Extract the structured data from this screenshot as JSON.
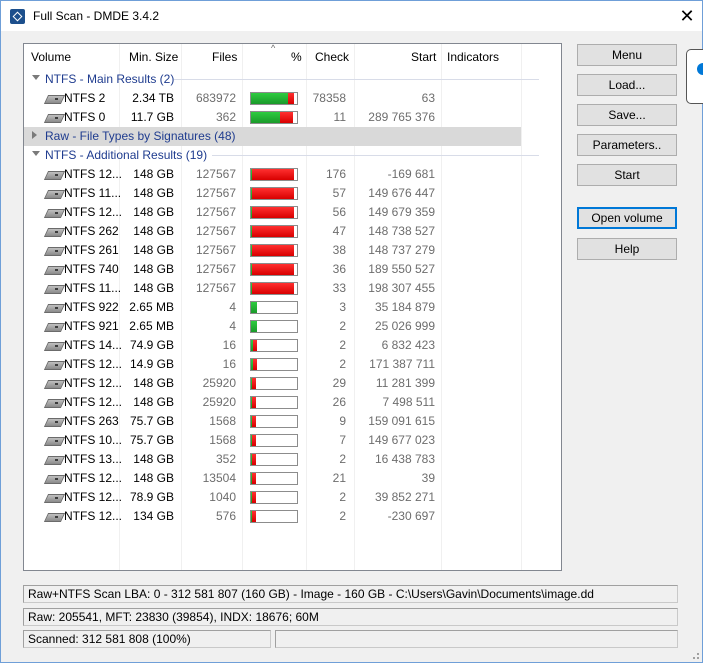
{
  "window": {
    "title": "Full Scan - DMDE 3.4.2",
    "close_glyph": "✕"
  },
  "columns": {
    "volume": "Volume",
    "min_size": "Min. Size",
    "files": "Files",
    "percent": "%",
    "check": "Check",
    "start": "Start",
    "indicators": "Indicators"
  },
  "groups": {
    "main": "NTFS - Main Results (2)",
    "raw": "Raw - File Types by Signatures (48)",
    "additional": "NTFS - Additional Results (19)"
  },
  "main_rows": [
    {
      "volume": "NTFS 2",
      "size": "2.34 TB",
      "files": "683972",
      "green": 0.8,
      "red": 0.14,
      "check": "78358",
      "start": "63"
    },
    {
      "volume": "NTFS 0",
      "size": "11.7 GB",
      "files": "362",
      "green": 0.62,
      "red": 0.28,
      "check": "11",
      "start": "289 765 376"
    }
  ],
  "additional_rows": [
    {
      "volume": "NTFS 12...",
      "size": "148 GB",
      "files": "127567",
      "green": 0.03,
      "red": 0.92,
      "check": "176",
      "start": "-169 681"
    },
    {
      "volume": "NTFS 11...",
      "size": "148 GB",
      "files": "127567",
      "green": 0.03,
      "red": 0.92,
      "check": "57",
      "start": "149 676 447"
    },
    {
      "volume": "NTFS 12...",
      "size": "148 GB",
      "files": "127567",
      "green": 0.03,
      "red": 0.92,
      "check": "56",
      "start": "149 679 359"
    },
    {
      "volume": "NTFS 262",
      "size": "148 GB",
      "files": "127567",
      "green": 0.03,
      "red": 0.92,
      "check": "47",
      "start": "148 738 527"
    },
    {
      "volume": "NTFS 261",
      "size": "148 GB",
      "files": "127567",
      "green": 0.03,
      "red": 0.92,
      "check": "38",
      "start": "148 737 279"
    },
    {
      "volume": "NTFS 740",
      "size": "148 GB",
      "files": "127567",
      "green": 0.03,
      "red": 0.92,
      "check": "36",
      "start": "189 550 527"
    },
    {
      "volume": "NTFS 11...",
      "size": "148 GB",
      "files": "127567",
      "green": 0.03,
      "red": 0.92,
      "check": "33",
      "start": "198 307 455"
    },
    {
      "volume": "NTFS 922",
      "size": "2.65 MB",
      "files": "4",
      "green": 0.12,
      "red": 0.0,
      "check": "3",
      "start": "35 184 879"
    },
    {
      "volume": "NTFS 921",
      "size": "2.65 MB",
      "files": "4",
      "green": 0.12,
      "red": 0.0,
      "check": "2",
      "start": "25 026 999"
    },
    {
      "volume": "NTFS 14...",
      "size": "74.9 GB",
      "files": "16",
      "green": 0.05,
      "red": 0.08,
      "check": "2",
      "start": "6 832 423"
    },
    {
      "volume": "NTFS 12...",
      "size": "14.9 GB",
      "files": "16",
      "green": 0.05,
      "red": 0.08,
      "check": "2",
      "start": "171 387 711"
    },
    {
      "volume": "NTFS 12...",
      "size": "148 GB",
      "files": "25920",
      "green": 0.03,
      "red": 0.08,
      "check": "29",
      "start": "11 281 399"
    },
    {
      "volume": "NTFS 12...",
      "size": "148 GB",
      "files": "25920",
      "green": 0.03,
      "red": 0.08,
      "check": "26",
      "start": "7 498 511"
    },
    {
      "volume": "NTFS 263",
      "size": "75.7 GB",
      "files": "1568",
      "green": 0.03,
      "red": 0.08,
      "check": "9",
      "start": "159 091 615"
    },
    {
      "volume": "NTFS 10...",
      "size": "75.7 GB",
      "files": "1568",
      "green": 0.03,
      "red": 0.08,
      "check": "7",
      "start": "149 677 023"
    },
    {
      "volume": "NTFS 13...",
      "size": "148 GB",
      "files": "352",
      "green": 0.03,
      "red": 0.08,
      "check": "2",
      "start": "16 438 783"
    },
    {
      "volume": "NTFS 12...",
      "size": "148 GB",
      "files": "13504",
      "green": 0.03,
      "red": 0.08,
      "check": "21",
      "start": "39"
    },
    {
      "volume": "NTFS 12...",
      "size": "78.9 GB",
      "files": "1040",
      "green": 0.03,
      "red": 0.08,
      "check": "2",
      "start": "39 852 271"
    },
    {
      "volume": "NTFS 12...",
      "size": "134 GB",
      "files": "576",
      "green": 0.03,
      "red": 0.08,
      "check": "2",
      "start": "-230 697"
    }
  ],
  "buttons": {
    "menu": "Menu",
    "load": "Load...",
    "save": "Save...",
    "parameters": "Parameters..",
    "start": "Start",
    "open_volume": "Open volume",
    "help": "Help"
  },
  "status": {
    "line1": "Raw+NTFS Scan LBA: 0 - 312 581 807 (160 GB) - Image - 160 GB - C:\\Users\\Gavin\\Documents\\image.dd",
    "line2": "Raw: 205541, MFT: 23830 (39854), INDX: 18676; 60M",
    "line3": "Scanned: 312 581 808 (100%)"
  },
  "colors": {
    "group_text": "#1f3c8f",
    "bar_green": "#1fb32f",
    "bar_red": "#e81010",
    "focus": "#0078d7"
  },
  "icons": {
    "drive": "drive-icon",
    "app": "dmde-app-icon",
    "expand": "triangle-icon"
  }
}
